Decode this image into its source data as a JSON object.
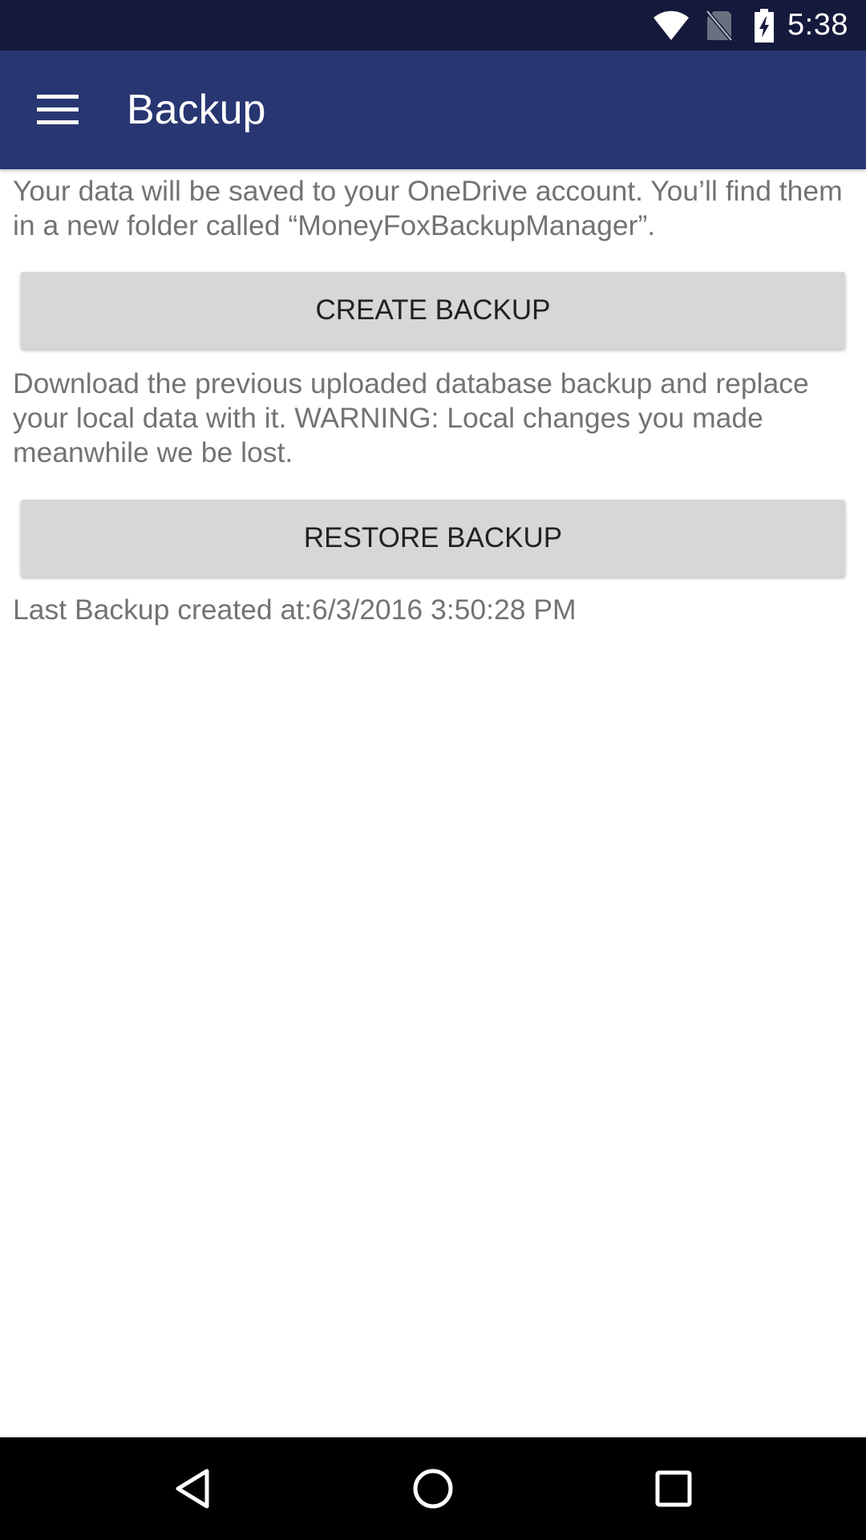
{
  "status_bar": {
    "time": "5:38",
    "background": "#151a3c",
    "icons": [
      "wifi-icon",
      "no-sim-icon",
      "battery-charging-icon"
    ]
  },
  "app_bar": {
    "title": "Backup",
    "background": "#283771",
    "menu_icon": "menu-icon"
  },
  "main": {
    "backup_description": "Your data will be saved to your OneDrive account. You’ll find them in a new folder called “MoneyFoxBackupManager”.",
    "create_button_label": "CREATE BACKUP",
    "restore_description": "Download the previous uploaded database backup and replace your local data with it. WARNING: Local changes you made meanwhile we be lost.",
    "restore_button_label": "RESTORE BACKUP",
    "last_backup_text": "Last Backup created at:6/3/2016 3:50:28 PM",
    "button_color": "#d6d7d7",
    "text_color": "#737373"
  },
  "nav_bar": {
    "icons": [
      "back-icon",
      "home-icon",
      "recents-icon"
    ]
  }
}
